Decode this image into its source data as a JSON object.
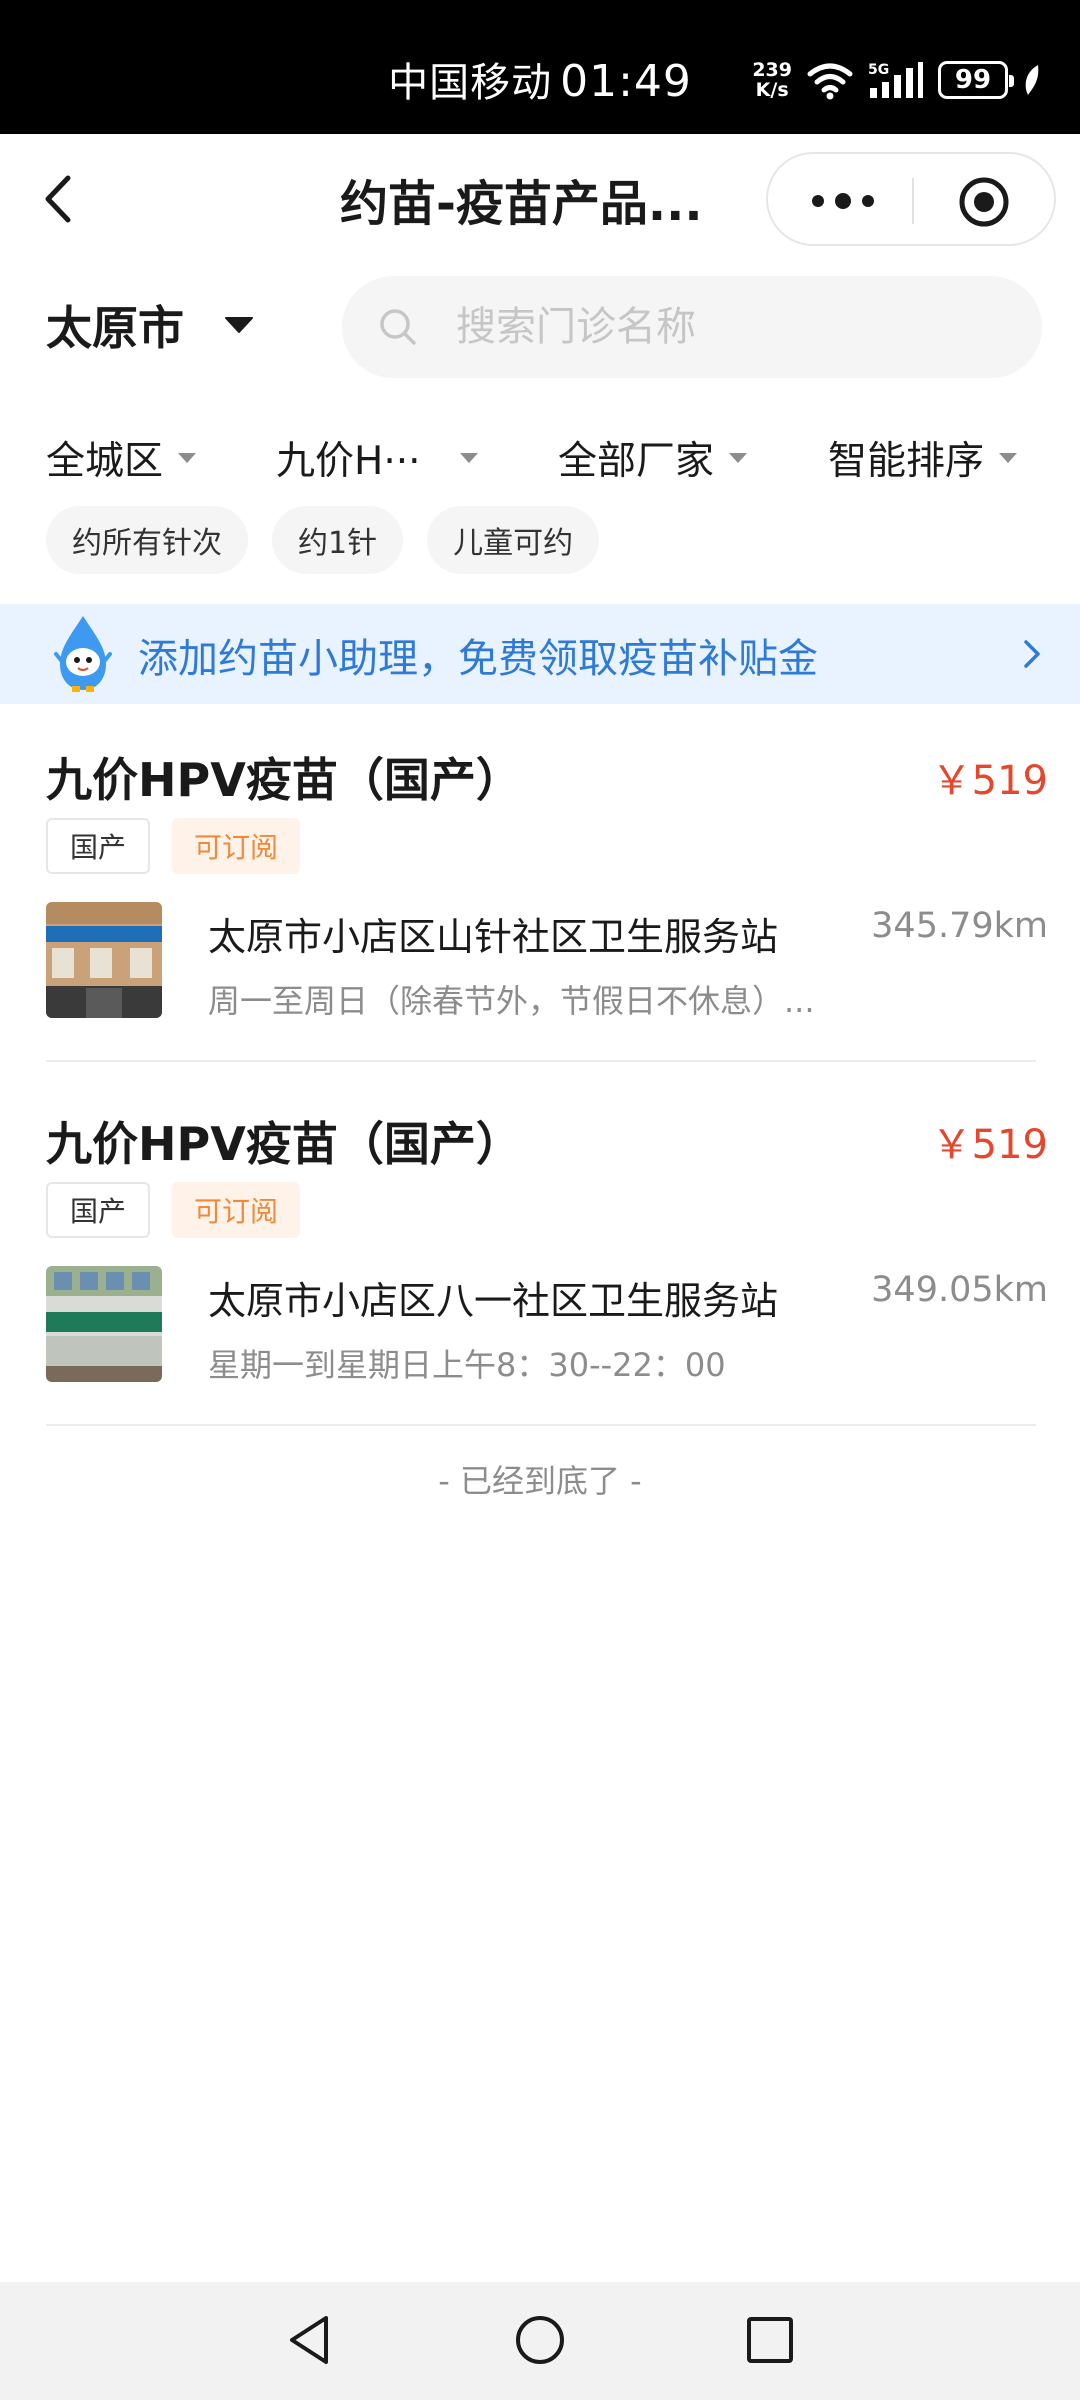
{
  "status_bar": {
    "carrier": "中国移动",
    "time": "01:49",
    "speed_value": "239",
    "speed_unit": "K/s",
    "network": "5G",
    "battery": "99"
  },
  "nav": {
    "title": "约苗-疫苗产品...",
    "icons": {
      "back": "back-icon",
      "more": "more-icon",
      "close": "close-icon"
    }
  },
  "city": {
    "label": "太原市"
  },
  "search": {
    "placeholder": "搜索门诊名称"
  },
  "filters": [
    "全城区",
    "九价H···",
    "全部厂家",
    "智能排序"
  ],
  "chips": [
    "约所有针次",
    "约1针",
    "儿童可约"
  ],
  "banner": {
    "text": "添加约苗小助理，免费领取疫苗补贴金"
  },
  "listings": [
    {
      "title": "九价HPV疫苗（国产）",
      "price": "￥519",
      "tags": [
        "国产",
        "可订阅"
      ],
      "clinic": "太原市小店区山针社区卫生服务站",
      "distance": "345.79km",
      "hours": "周一至周日（除春节外，节假日不休息）..."
    },
    {
      "title": "九价HPV疫苗（国产）",
      "price": "￥519",
      "tags": [
        "国产",
        "可订阅"
      ],
      "clinic": "太原市小店区八一社区卫生服务站",
      "distance": "349.05km",
      "hours": "星期一到星期日上午8：30--22：00"
    }
  ],
  "footer": {
    "end_text": "- 已经到底了 -"
  },
  "colors": {
    "price": "#e4472b",
    "accent_blue": "#2f7ad7",
    "tag_orange": "#f08a3a",
    "banner_bg": "#e9f3ff"
  }
}
